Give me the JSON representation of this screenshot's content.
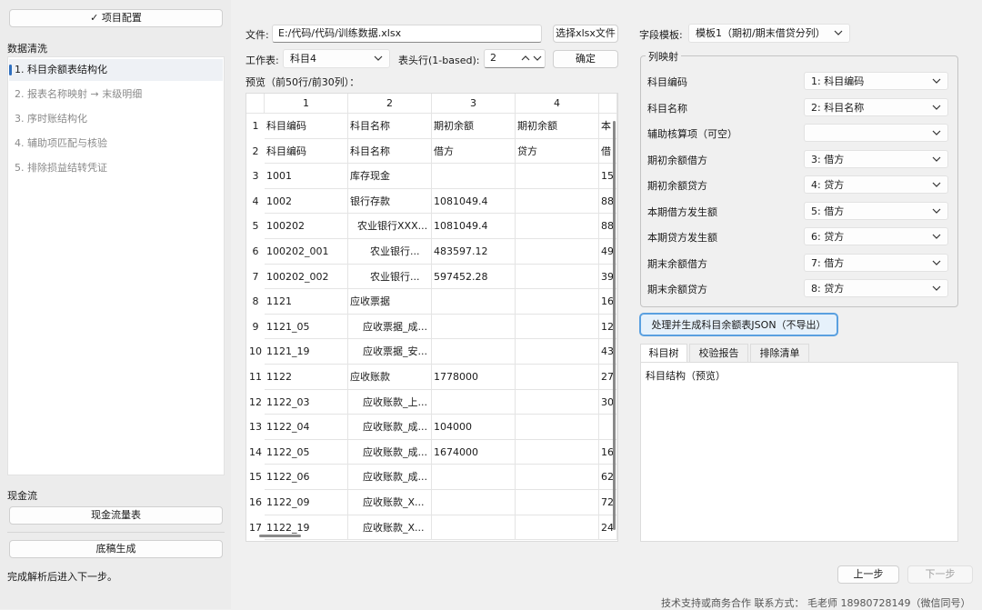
{
  "sidebar": {
    "project_button": "✓ 项目配置",
    "section_clean": "数据清洗",
    "steps": [
      "1. 科目余额表结构化",
      "2. 报表名称映射 → 末级明细",
      "3. 序时账结构化",
      "4. 辅助项匹配与核验",
      "5. 排除损益结转凭证"
    ],
    "section_cash": "现金流",
    "cashflow_button": "现金流量表",
    "draft_button": "底稿生成",
    "status": "完成解析后进入下一步。"
  },
  "file": {
    "label": "文件:",
    "value": "E:/代码/代码/训练数据.xlsx",
    "choose_button": "选择xlsx文件"
  },
  "sheet": {
    "label": "工作表:",
    "value": "科目4",
    "header_label": "表头行(1-based):",
    "header_value": "2",
    "confirm_button": "确定"
  },
  "template": {
    "label": "字段模板:",
    "value": "模板1（期初/期末借贷分列）"
  },
  "preview": {
    "label": "预览（前50行/前30列）：",
    "columns": [
      "1",
      "2",
      "3",
      "4",
      "本"
    ],
    "rows": [
      [
        "1",
        "科目编码",
        "科目名称",
        "期初余额",
        "期初余额",
        "本"
      ],
      [
        "2",
        "科目编码",
        "科目名称",
        "借方",
        "贷方",
        "借"
      ],
      [
        "3",
        "1001",
        "库存现金",
        "",
        "",
        "15"
      ],
      [
        "4",
        "1002",
        "银行存款",
        "1081049.4",
        "",
        "88"
      ],
      [
        "5",
        "100202",
        "农业银行XXX...",
        "1081049.4",
        "",
        "88"
      ],
      [
        "6",
        "100202_001",
        "农业银行...",
        "483597.12",
        "",
        "49"
      ],
      [
        "7",
        "100202_002",
        "农业银行...",
        "597452.28",
        "",
        "39"
      ],
      [
        "8",
        "1121",
        "应收票据",
        "",
        "",
        "16"
      ],
      [
        "9",
        "1121_05",
        "应收票据_成...",
        "",
        "",
        "12"
      ],
      [
        "10",
        "1121_19",
        "应收票据_安...",
        "",
        "",
        "43"
      ],
      [
        "11",
        "1122",
        "应收账款",
        "1778000",
        "",
        "27"
      ],
      [
        "12",
        "1122_03",
        "应收账款_上...",
        "",
        "",
        "30"
      ],
      [
        "13",
        "1122_04",
        "应收账款_成...",
        "104000",
        "",
        ""
      ],
      [
        "14",
        "1122_05",
        "应收账款_成...",
        "1674000",
        "",
        "16"
      ],
      [
        "15",
        "1122_06",
        "应收账款_成...",
        "",
        "",
        "62"
      ],
      [
        "16",
        "1122_09",
        "应收账款_X...",
        "",
        "",
        "72"
      ],
      [
        "17",
        "1122_19",
        "应收账款_X...",
        "",
        "",
        "24"
      ]
    ]
  },
  "column_map": {
    "title": "列映射",
    "fields": [
      {
        "label": "科目编码",
        "value": "1: 科目编码"
      },
      {
        "label": "科目名称",
        "value": "2: 科目名称"
      },
      {
        "label": "辅助核算项（可空）",
        "value": ""
      },
      {
        "label": "期初余额借方",
        "value": "3: 借方"
      },
      {
        "label": "期初余额贷方",
        "value": "4: 贷方"
      },
      {
        "label": "本期借方发生额",
        "value": "5: 借方"
      },
      {
        "label": "本期贷方发生额",
        "value": "6: 贷方"
      },
      {
        "label": "期末余额借方",
        "value": "7: 借方"
      },
      {
        "label": "期末余额贷方",
        "value": "8: 贷方"
      }
    ]
  },
  "process_button": "处理并生成科目余额表JSON（不导出）",
  "tabs": [
    "科目树",
    "校验报告",
    "排除清单"
  ],
  "tree_text": "科目结构（预览）",
  "nav": {
    "prev": "上一步",
    "next": "下一步"
  },
  "footer": "技术支持或商务合作 联系方式： 毛老师 18980728149（微信同号）",
  "colors": {
    "accent": "#2e6fbf",
    "process_border": "#5aa0e0",
    "process_bg": "#e6f1fb"
  }
}
